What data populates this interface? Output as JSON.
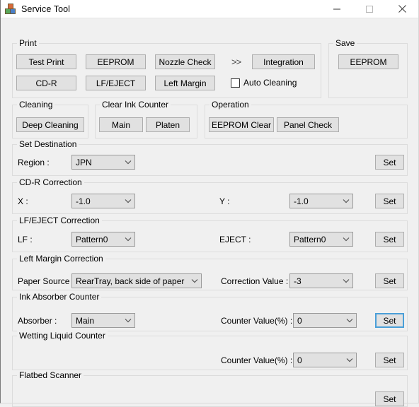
{
  "window": {
    "title": "Service Tool",
    "icon": "app-blocks-icon",
    "controls": {
      "minimize": "minimize-icon",
      "maximize": "maximize-icon",
      "close": "close-icon"
    }
  },
  "groups": {
    "print": {
      "legend": "Print",
      "buttons": [
        {
          "label": "Test Print"
        },
        {
          "label": "EEPROM"
        },
        {
          "label": "Nozzle Check"
        },
        {
          "label": "CD-R"
        },
        {
          "label": "LF/EJECT"
        },
        {
          "label": "Left Margin"
        },
        {
          "label": "Integration"
        }
      ],
      "arrows": ">>",
      "auto_cleaning": {
        "label": "Auto Cleaning",
        "checked": false
      }
    },
    "save": {
      "legend": "Save",
      "buttons": [
        {
          "label": "EEPROM"
        }
      ]
    },
    "cleaning": {
      "legend": "Cleaning",
      "buttons": [
        {
          "label": "Deep Cleaning"
        }
      ]
    },
    "clear_ink_counter": {
      "legend": "Clear Ink Counter",
      "buttons": [
        {
          "label": "Main"
        },
        {
          "label": "Platen"
        }
      ]
    },
    "operation": {
      "legend": "Operation",
      "buttons": [
        {
          "label": "EEPROM Clear"
        },
        {
          "label": "Panel Check"
        }
      ]
    },
    "set_destination": {
      "legend": "Set Destination",
      "region_label": "Region :",
      "region_value": "JPN",
      "set_label": "Set"
    },
    "cdr_correction": {
      "legend": "CD-R Correction",
      "x_label": "X :",
      "x_value": "-1.0",
      "y_label": "Y :",
      "y_value": "-1.0",
      "set_label": "Set"
    },
    "lf_eject_correction": {
      "legend": "LF/EJECT Correction",
      "lf_label": "LF :",
      "lf_value": "Pattern0",
      "eject_label": "EJECT :",
      "eject_value": "Pattern0",
      "set_label": "Set"
    },
    "left_margin_correction": {
      "legend": "Left Margin Correction",
      "paper_source_label": "Paper Source :",
      "paper_source_value": "RearTray, back side of paper",
      "correction_value_label": "Correction Value :",
      "correction_value": "-3",
      "set_label": "Set"
    },
    "ink_absorber_counter": {
      "legend": "Ink Absorber Counter",
      "absorber_label": "Absorber :",
      "absorber_value": "Main",
      "counter_label": "Counter Value(%) :",
      "counter_value": "0",
      "set_label": "Set"
    },
    "wetting_liquid_counter": {
      "legend": "Wetting Liquid Counter",
      "counter_label": "Counter Value(%) :",
      "counter_value": "0",
      "set_label": "Set"
    },
    "flatbed_scanner": {
      "legend": "Flatbed Scanner",
      "set_label": "Set"
    }
  },
  "colors": {
    "window_bg": "#f0f0f0",
    "button_face": "#e1e1e1",
    "button_border": "#adadad",
    "focus_blue": "#4a9fd8",
    "group_border": "#dcdcdc"
  }
}
